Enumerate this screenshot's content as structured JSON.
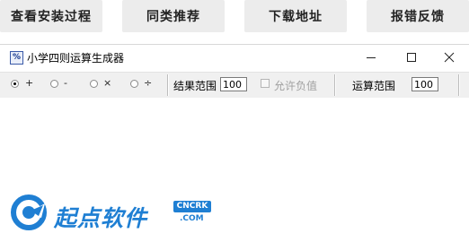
{
  "top_buttons": [
    {
      "label": "查看安装过程"
    },
    {
      "label": "同类推荐"
    },
    {
      "label": "下载地址"
    },
    {
      "label": "报错反馈"
    }
  ],
  "window": {
    "icon_glyph": "%",
    "title": "小学四则运算生成器"
  },
  "toolbar": {
    "ops": [
      {
        "symbol": "+",
        "selected": true
      },
      {
        "symbol": "-",
        "selected": false
      },
      {
        "symbol": "×",
        "selected": false
      },
      {
        "symbol": "÷",
        "selected": false
      }
    ],
    "result_range_label": "结果范围",
    "result_range_value": "100",
    "allow_negative_label": "允许负值",
    "allow_negative_checked": false,
    "op_range_label": "运算范围",
    "op_range_value": "100"
  },
  "watermark": {
    "brand": "起点软件",
    "badge": "CNCRK",
    "domain": ".COM"
  },
  "colors": {
    "brand_blue": "#1f7fd3",
    "button_bg": "#ececec",
    "toolbar_bg": "#f0f0f0"
  }
}
